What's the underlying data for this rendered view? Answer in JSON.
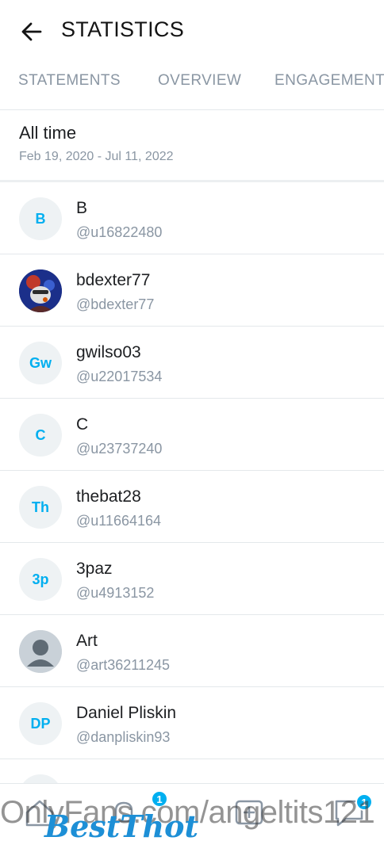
{
  "header": {
    "title": "STATISTICS"
  },
  "tabs": [
    "STATEMENTS",
    "OVERVIEW",
    "ENGAGEMENT"
  ],
  "period": {
    "title": "All time",
    "range": "Feb 19, 2020 - Jul 11, 2022"
  },
  "users": [
    {
      "initials": "B",
      "name": "B",
      "handle": "@u16822480",
      "avatar": "initials"
    },
    {
      "initials": "",
      "name": "bdexter77",
      "handle": "@bdexter77",
      "avatar": "photo"
    },
    {
      "initials": "Gw",
      "name": "gwilso03",
      "handle": "@u22017534",
      "avatar": "initials"
    },
    {
      "initials": "C",
      "name": "C",
      "handle": "@u23737240",
      "avatar": "initials"
    },
    {
      "initials": "Th",
      "name": "thebat28",
      "handle": "@u11664164",
      "avatar": "initials"
    },
    {
      "initials": "3p",
      "name": "3paz",
      "handle": "@u4913152",
      "avatar": "initials"
    },
    {
      "initials": "",
      "name": "Art",
      "handle": "@art36211245",
      "avatar": "default"
    },
    {
      "initials": "DP",
      "name": "Daniel Pliskin",
      "handle": "@danpliskin93",
      "avatar": "initials"
    }
  ],
  "bottom_nav": {
    "items": [
      "home-icon",
      "notifications-icon",
      "add-post-icon",
      "messages-icon",
      "chat-icon"
    ],
    "notification_badge": "1",
    "chat_badge": "1"
  },
  "watermark": {
    "text": "OnlyFans.com/angeltits121",
    "logo": "BestThot"
  },
  "colors": {
    "accent": "#00aff0",
    "muted": "#8a96a3",
    "divider": "#e4e8eb"
  }
}
